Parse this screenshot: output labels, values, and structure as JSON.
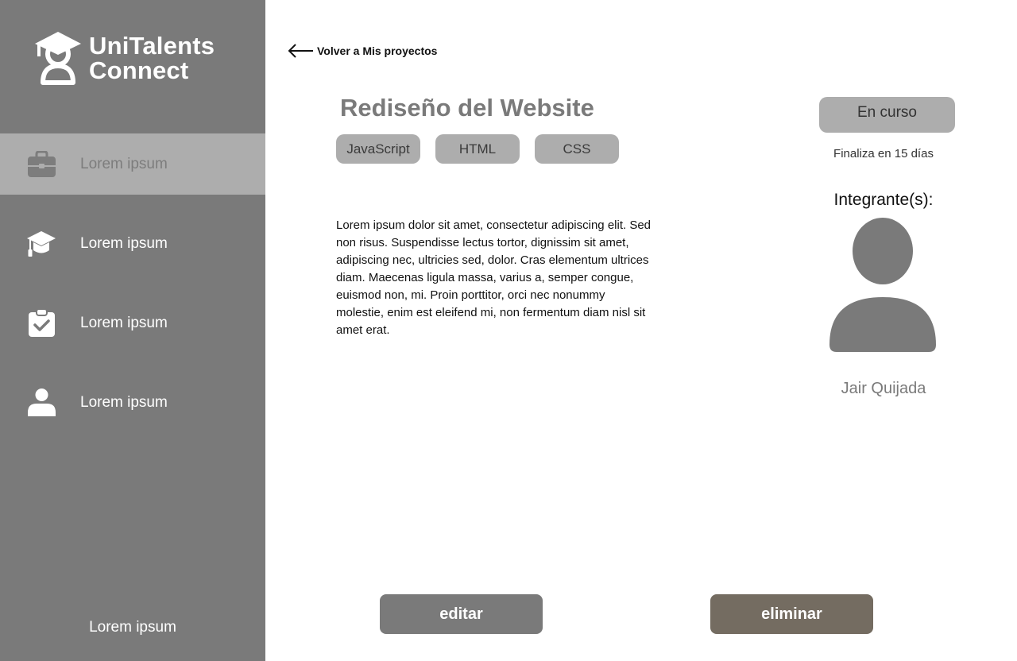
{
  "brand": {
    "line1": "UniTalents",
    "line2": "Connect",
    "icon": "graduate-person-logo"
  },
  "sidebar": {
    "items": [
      {
        "label": "Lorem ipsum",
        "icon": "briefcase-icon",
        "active": true
      },
      {
        "label": "Lorem ipsum",
        "icon": "graduation-cap-icon",
        "active": false
      },
      {
        "label": "Lorem ipsum",
        "icon": "clipboard-check-icon",
        "active": false
      },
      {
        "label": "Lorem ipsum",
        "icon": "user-icon",
        "active": false
      }
    ],
    "footer": "Lorem ipsum"
  },
  "back_link": {
    "label": "Volver a Mis proyectos",
    "icon": "arrow-left-icon"
  },
  "project": {
    "title": "Rediseño del Website",
    "tags": [
      "JavaScript",
      "HTML",
      "CSS"
    ],
    "description": "Lorem ipsum dolor sit amet, consectetur adipiscing elit. Sed non risus. Suspendisse lectus tortor, dignissim sit amet, adipiscing nec, ultricies sed, dolor. Cras elementum ultrices diam. Maecenas ligula massa, varius a, semper congue, euismod non, mi. Proin porttitor, orci nec nonummy molestie, enim est eleifend mi, non fermentum diam nisl sit amet erat.",
    "status": "En curso",
    "deadline": "Finaliza en 15 días"
  },
  "members": {
    "title": "Integrante(s):",
    "list": [
      {
        "name": "Jair Quijada",
        "icon": "avatar-placeholder-icon"
      }
    ]
  },
  "actions": {
    "edit": "editar",
    "delete": "eliminar"
  },
  "colors": {
    "sidebar_bg": "#7a7a7a",
    "active_item_bg": "#adadad",
    "tag_bg": "#adadad",
    "edit_button": "#7a7a7a",
    "delete_button": "#746c61"
  }
}
